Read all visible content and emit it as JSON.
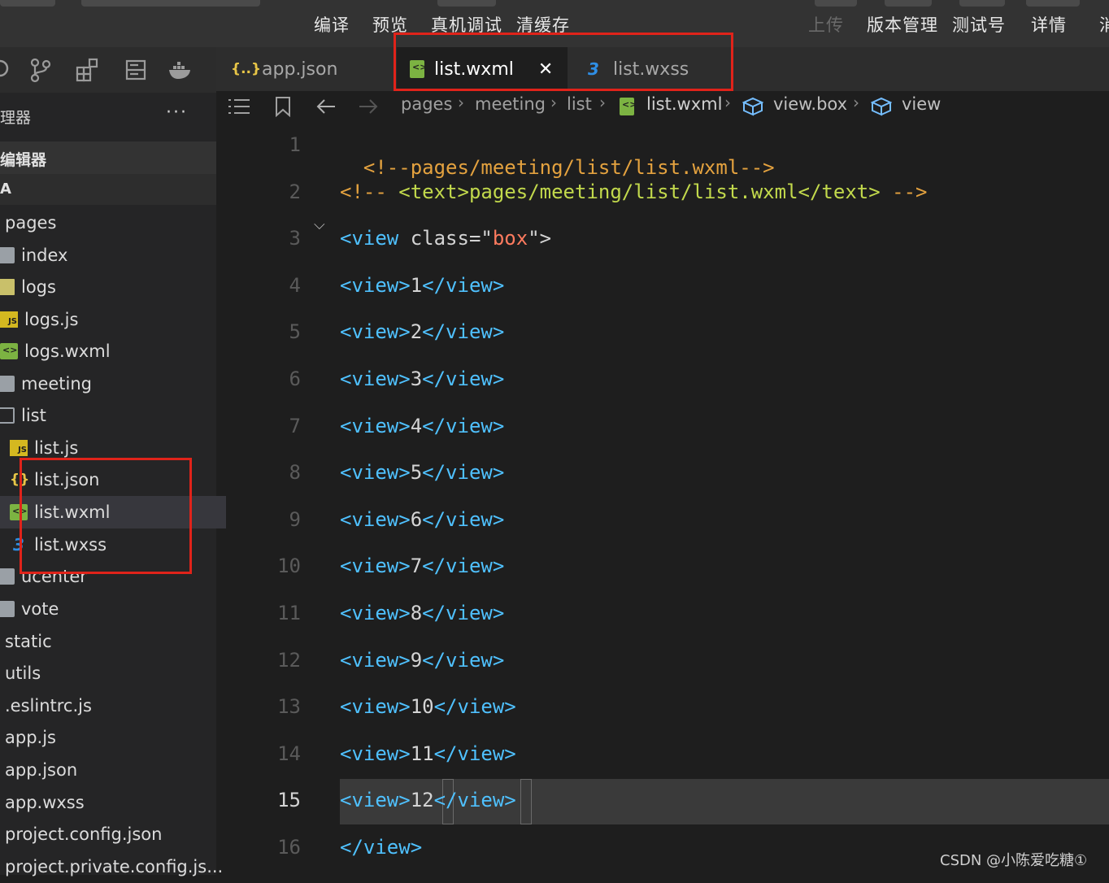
{
  "toolbar": {
    "compile": "编译",
    "preview": "预览",
    "device_debug": "真机调试",
    "clear_cache": "清缓存",
    "upload": "上传",
    "version": "版本管理",
    "test_id": "测试号",
    "details": "详情",
    "cut_off": "消"
  },
  "sidebar": {
    "title": "理器",
    "more": "···",
    "open_editors": "编辑器",
    "project": "A",
    "tree": [
      {
        "label": "pages",
        "type": "folder"
      },
      {
        "label": "index",
        "type": "folder"
      },
      {
        "label": "logs",
        "type": "folder"
      },
      {
        "label": "logs.js",
        "type": "js"
      },
      {
        "label": "logs.wxml",
        "type": "wxml"
      },
      {
        "label": "meeting",
        "type": "folder"
      },
      {
        "label": "list",
        "type": "folder-open"
      },
      {
        "label": "list.js",
        "type": "js"
      },
      {
        "label": "list.json",
        "type": "json"
      },
      {
        "label": "list.wxml",
        "type": "wxml",
        "selected": true
      },
      {
        "label": "list.wxss",
        "type": "wxss"
      },
      {
        "label": "ucenter",
        "type": "folder"
      },
      {
        "label": "vote",
        "type": "folder"
      },
      {
        "label": "static",
        "type": "folder"
      },
      {
        "label": "utils",
        "type": "folder"
      },
      {
        "label": ".eslintrc.js",
        "type": "file"
      },
      {
        "label": "app.js",
        "type": "file"
      },
      {
        "label": "app.json",
        "type": "file"
      },
      {
        "label": "app.wxss",
        "type": "file"
      },
      {
        "label": "project.config.json",
        "type": "file"
      },
      {
        "label": "project.private.config.js...",
        "type": "file"
      }
    ]
  },
  "tabs": [
    {
      "label": "app.json",
      "icon": "json-icon"
    },
    {
      "label": "list.wxml",
      "icon": "wxml-icon",
      "active": true,
      "close": "✕"
    },
    {
      "label": "list.wxss",
      "icon": "wxss-icon"
    }
  ],
  "breadcrumb": [
    "pages",
    "meeting",
    "list",
    "list.wxml",
    "view.box",
    "view"
  ],
  "code": {
    "line1": "<!--pages/meeting/list/list.wxml-->",
    "line2_open": "<!-- ",
    "line2_tag_open": "<text>",
    "line2_text": "pages/meeting/list/list.wxml",
    "line2_tag_close": "</text>",
    "line2_close": " -->",
    "line3_tag": "<view",
    "line3_attr": " class=\"",
    "line3_str": "box",
    "line3_end": "\">",
    "view_open": "<view>",
    "view_close": "</view>",
    "items": [
      "1",
      "2",
      "3",
      "4",
      "5",
      "6",
      "7",
      "8",
      "9",
      "10",
      "11",
      "12"
    ],
    "line16": "</view>",
    "line_numbers": [
      "1",
      "2",
      "3",
      "4",
      "5",
      "6",
      "7",
      "8",
      "9",
      "10",
      "11",
      "12",
      "13",
      "14",
      "15",
      "16"
    ],
    "current_line": "15"
  },
  "watermark": "CSDN @小陈爱吃糖①"
}
